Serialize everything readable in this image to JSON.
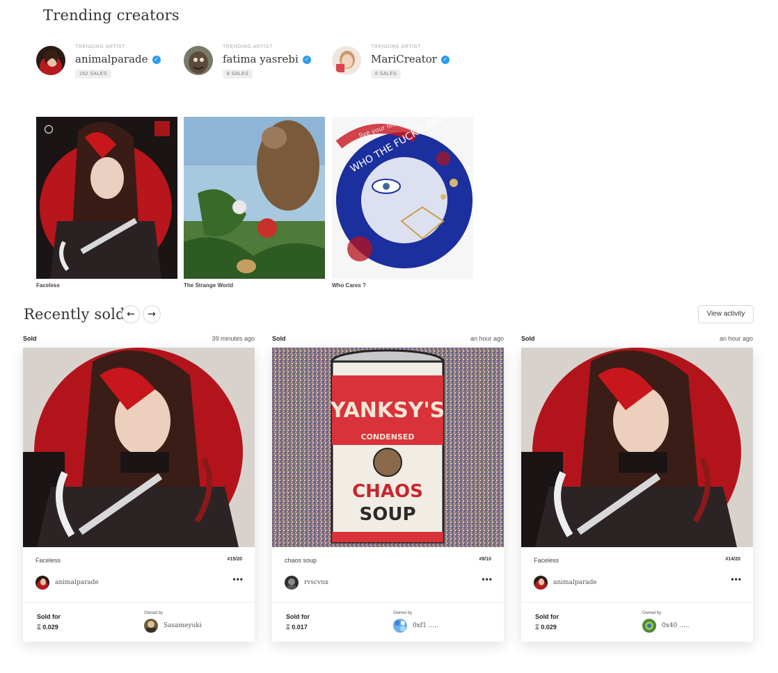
{
  "trending": {
    "title": "Trending creators",
    "creators": [
      {
        "label": "TRENDING ARTIST",
        "name": "animalparade",
        "sales": "162 SALES"
      },
      {
        "label": "TRENDING ARTIST",
        "name": "fatima yasrebi",
        "sales": "8 SALES"
      },
      {
        "label": "TRENDING ARTIST",
        "name": "MariCreator",
        "sales": "6 SALES"
      }
    ],
    "artworks": [
      {
        "caption": "Faceless"
      },
      {
        "caption": "The Strange World"
      },
      {
        "caption": "Who Cares ?"
      }
    ],
    "artwork_text": {
      "line1": "live your life",
      "line2": "WHO THE FUCK CARES ?"
    }
  },
  "recent": {
    "title": "Recently sold",
    "prev_icon": "arrow-left-icon",
    "next_icon": "arrow-right-icon",
    "prev_glyph": "←",
    "next_glyph": "→",
    "view_activity": "View activity",
    "cards": [
      {
        "status": "Sold",
        "time": "39 minutes ago",
        "title": "Faceless",
        "edition": "#15/20",
        "artist": "animalparade",
        "more": "•••",
        "sold_for_label": "Sold for",
        "price": "Ξ 0.029",
        "owned_by_label": "Owned by",
        "owner": "Sasameyuki"
      },
      {
        "status": "Sold",
        "time": "an hour ago",
        "title": "chaos soup",
        "edition": "#9/10",
        "artist": "rvscvnx",
        "more": "•••",
        "sold_for_label": "Sold for",
        "price": "Ξ 0.017",
        "owned_by_label": "Owned by",
        "owner": "0xf1 ....."
      },
      {
        "status": "Sold",
        "time": "an hour ago",
        "title": "Faceless",
        "edition": "#14/20",
        "artist": "animalparade",
        "more": "•••",
        "sold_for_label": "Sold for",
        "price": "Ξ 0.029",
        "owned_by_label": "Owned by",
        "owner": "0x40 ....."
      }
    ],
    "soup_can": {
      "brand": "YANKSY'S",
      "sub": "CONDENSED",
      "line1": "CHAOS",
      "line2": "SOUP"
    }
  },
  "colors": {
    "verified": "#2a9bec",
    "accent_red": "#c8161d"
  },
  "icons": {
    "verified": "verified-check-icon",
    "timer": "timer-icon",
    "more": "more-dots-icon"
  }
}
